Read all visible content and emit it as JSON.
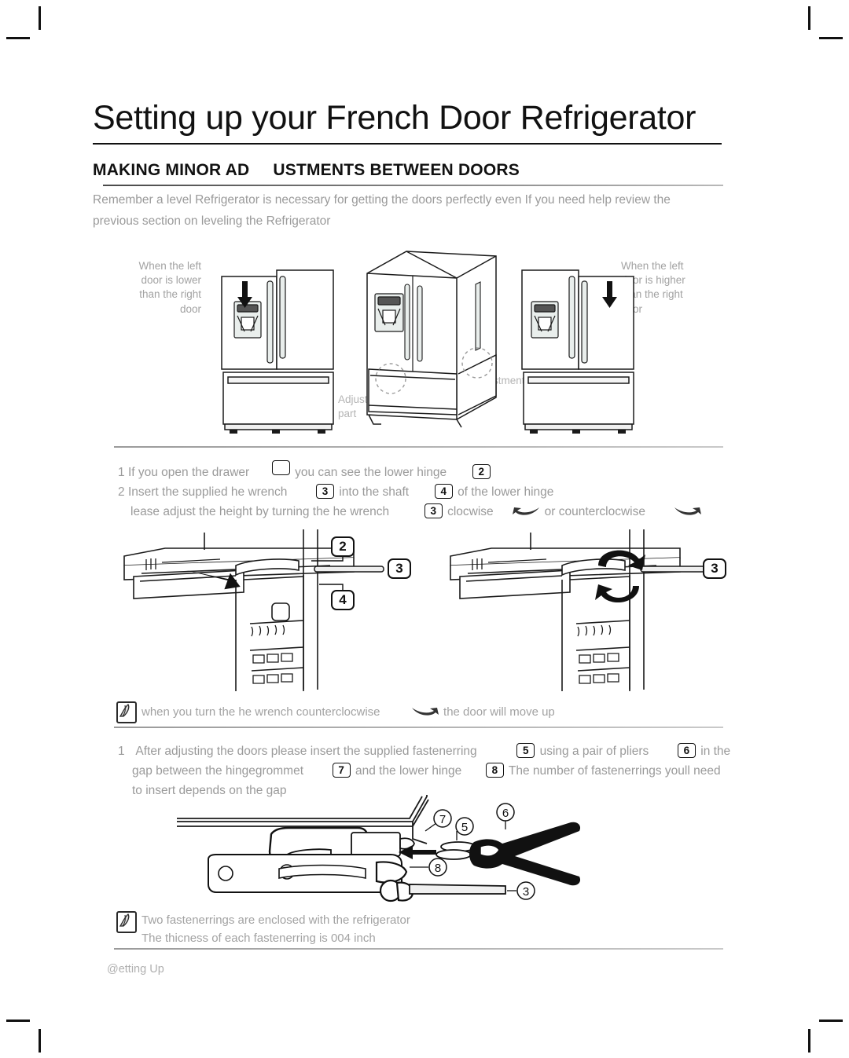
{
  "document": {
    "page_title": "Setting up your French Door Refrigerator",
    "section_heading_part1": "MAKING MINOR AD",
    "section_heading_part2": "USTMENTS BETWEEN DOORS",
    "intro_line1": "Remember a level Refrigerator is necessary for getting the doors perfectly even If you need help review the",
    "intro_line2": "previous section on leveling the Refrigerator",
    "footer": "@etting Up"
  },
  "figures": {
    "left_caption": "When the left door is lower than the right door",
    "right_caption": "When the left door is higher than the right door",
    "adjustment_label_left": "Adjustment part",
    "adjustment_label_right": "Adjustment part"
  },
  "steps_block_1": {
    "line1": {
      "number": "1",
      "text_a": "If you open the drawer",
      "badge_a": "",
      "text_b": "you can see the lower hinge",
      "badge_b": "2"
    },
    "line2": {
      "number": "2",
      "text_a": "Insert the supplied he wrench",
      "badge_a": "3",
      "text_b": "into the shaft",
      "badge_b": "4",
      "text_c": "of the lower hinge"
    },
    "line3": {
      "text_a": "lease adjust the height by turning the he wrench",
      "badge_a": "3",
      "text_b": "clocwise",
      "arrow_a": "curved-arrow-left",
      "text_c": "or counterclocwise",
      "arrow_b": "curved-arrow-right"
    }
  },
  "callouts_mid_left": [
    "2",
    "3",
    "4"
  ],
  "callouts_mid_right": [
    "3"
  ],
  "note_1": {
    "icon": "note-pencil-icon",
    "text_a": "when you turn the he wrench counterclocwise",
    "arrow": "curved-arrow-right",
    "text_b": "the door will move up"
  },
  "steps_block_2": {
    "line1": {
      "number": "1",
      "text_a": "After adjusting the doors please insert the supplied fastenerring",
      "badge_a": "5",
      "text_b": "using a pair of pliers",
      "badge_b": "6",
      "text_c": "in the"
    },
    "line2": {
      "text_a": "gap between the hingegrommet",
      "badge_a": "7",
      "text_b": "and the lower hinge",
      "badge_b": "8",
      "text_c": "The number of fastenerrings youll need"
    },
    "line3": {
      "text_a": "to insert depends on the gap"
    }
  },
  "callouts_bottom": [
    "7",
    "5",
    "6",
    "8",
    "3"
  ],
  "note_2": {
    "icon": "note-pencil-icon",
    "line1": "Two fastenerrings are enclosed with the refrigerator",
    "line2": "The thicness of each fastenerring is 004 inch"
  }
}
